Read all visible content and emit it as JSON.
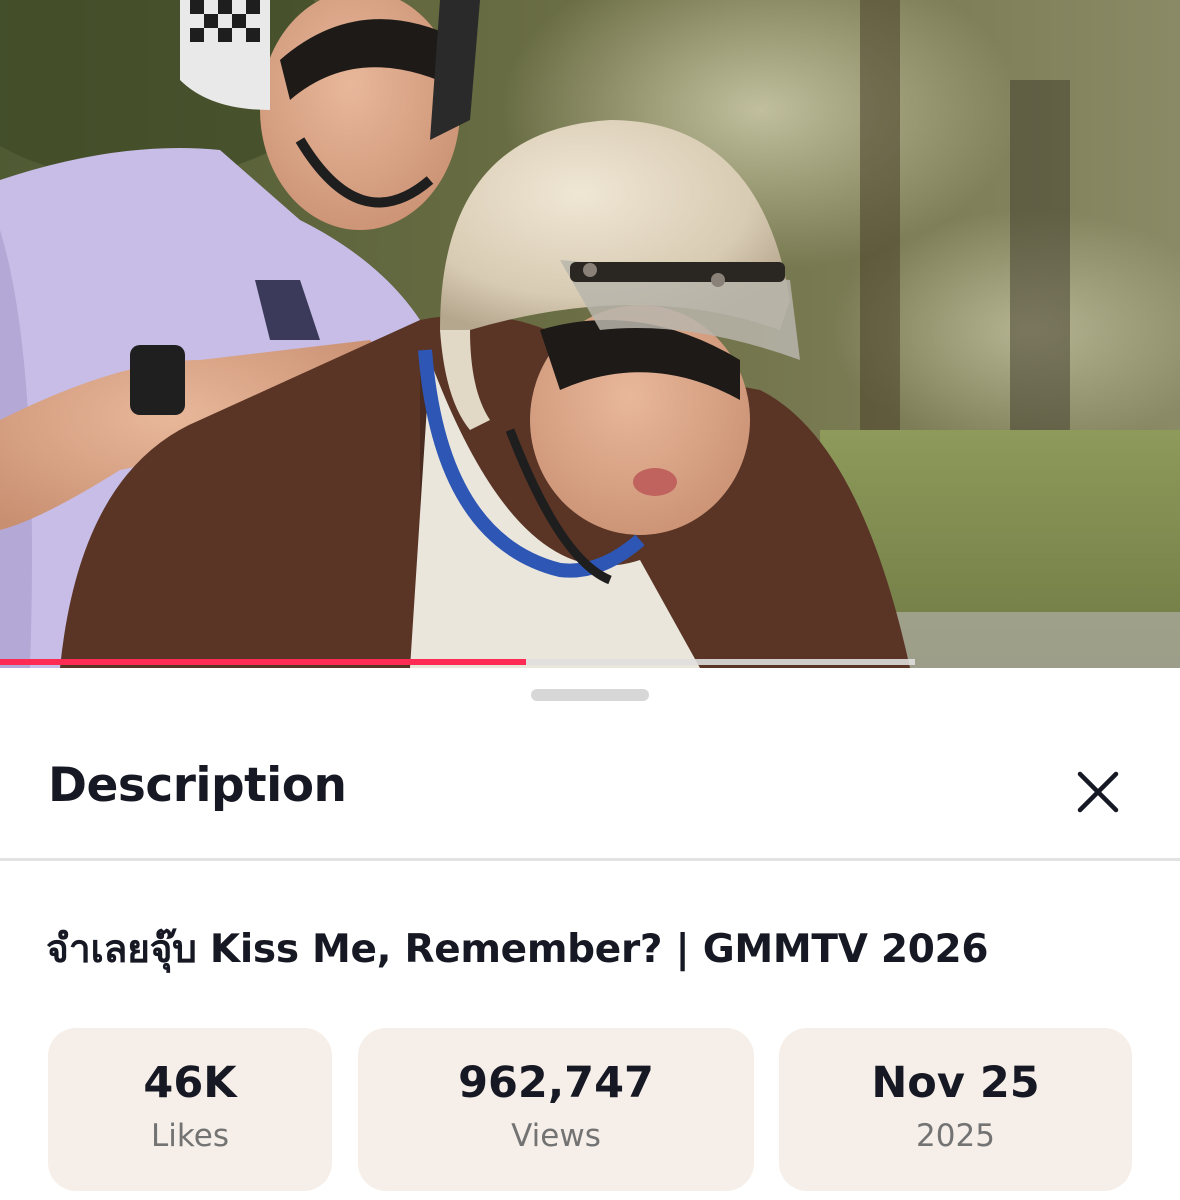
{
  "video": {
    "progress_fraction": 0.446,
    "buffered_fraction": 0.775
  },
  "sheet": {
    "title": "Description",
    "video_title": "จำเลยจุ๊บ Kiss Me, Remember? | GMMTV 2026"
  },
  "stats": {
    "likes": {
      "value": "46K",
      "label": "Likes"
    },
    "views": {
      "value": "962,747",
      "label": "Views"
    },
    "date": {
      "value": "Nov 25",
      "label": "2025"
    }
  },
  "colors": {
    "accent": "#fe2c55",
    "stat_background": "#f6efe9",
    "text": "#161823",
    "muted": "#737373"
  },
  "icons": {
    "close": "close-icon"
  }
}
